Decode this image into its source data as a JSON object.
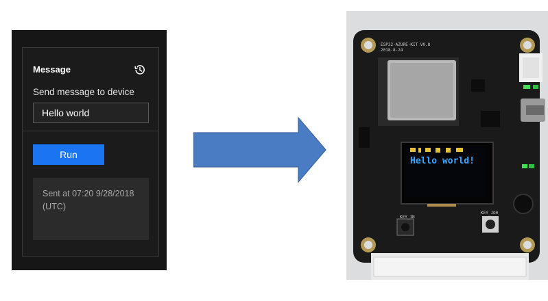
{
  "panel": {
    "title": "Message",
    "history_icon": "history-icon",
    "field_label": "Send message to device",
    "input_value": "Hello world",
    "run_label": "Run",
    "status_text": "Sent at 07:20 9/28/2018 (UTC)"
  },
  "arrow": {
    "icon": "right-arrow-icon",
    "color": "#4a7cc3"
  },
  "device": {
    "board_label": "ESP32-AZURE-KIT  V0.8",
    "board_date": "2018-8-24",
    "display_text": "Hello world!",
    "key_in_label": "KEY_IN",
    "key_io_label": "KEY_IO0",
    "oled_color": "#38a8ff",
    "board_color": "#1a1a1a"
  }
}
